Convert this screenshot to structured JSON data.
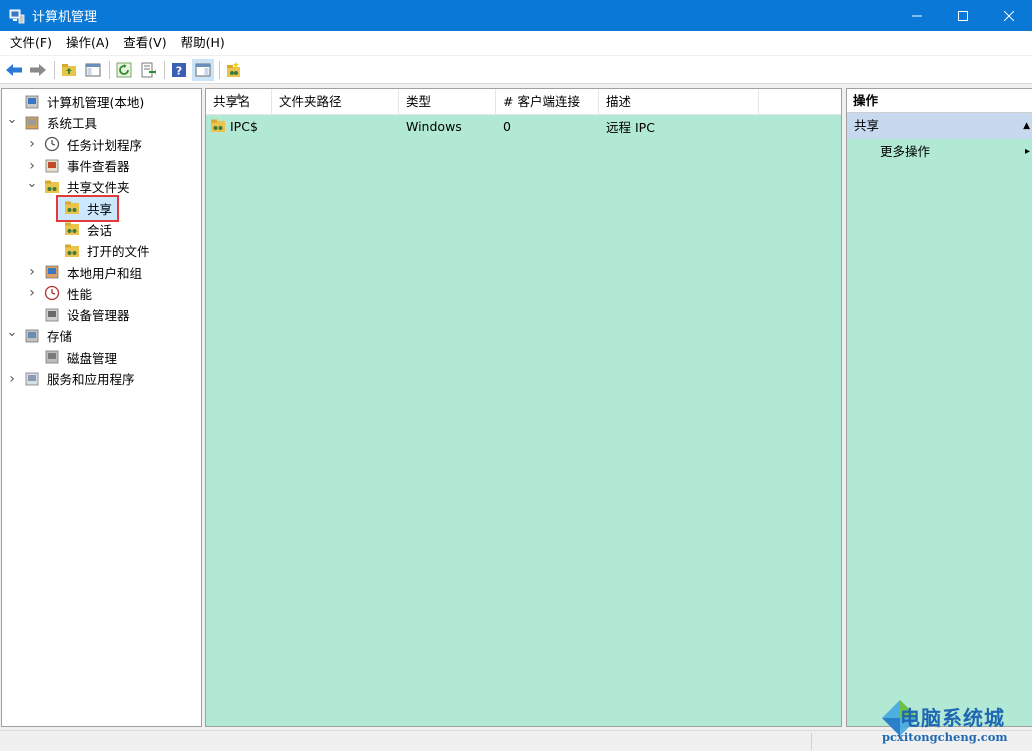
{
  "window": {
    "title": "计算机管理",
    "minimize_icon": "minimize-icon",
    "maximize_icon": "maximize-icon",
    "close_icon": "close-icon",
    "accent": "#0a78d7"
  },
  "menu": [
    "文件(F)",
    "操作(A)",
    "查看(V)",
    "帮助(H)"
  ],
  "tree": [
    {
      "label": "计算机管理(本地)",
      "icon": "computer-management-icon",
      "level": 0,
      "arrow": ""
    },
    {
      "label": "系统工具",
      "icon": "system-tools-icon",
      "level": 0,
      "arrow": "expanded"
    },
    {
      "label": "任务计划程序",
      "icon": "task-scheduler-icon",
      "level": 1,
      "arrow": "collapsed"
    },
    {
      "label": "事件查看器",
      "icon": "event-viewer-icon",
      "level": 1,
      "arrow": "collapsed"
    },
    {
      "label": "共享文件夹",
      "icon": "shared-folder-icon",
      "level": 1,
      "arrow": "expanded"
    },
    {
      "label": "共享",
      "icon": "shares-icon",
      "level": 2,
      "arrow": "",
      "selected": true
    },
    {
      "label": "会话",
      "icon": "sessions-icon",
      "level": 2,
      "arrow": ""
    },
    {
      "label": "打开的文件",
      "icon": "open-files-icon",
      "level": 2,
      "arrow": ""
    },
    {
      "label": "本地用户和组",
      "icon": "local-users-icon",
      "level": 1,
      "arrow": "collapsed"
    },
    {
      "label": "性能",
      "icon": "performance-icon",
      "level": 1,
      "arrow": "collapsed"
    },
    {
      "label": "设备管理器",
      "icon": "device-manager-icon",
      "level": 1,
      "arrow": ""
    },
    {
      "label": "存储",
      "icon": "storage-icon",
      "level": 0,
      "arrow": "expanded"
    },
    {
      "label": "磁盘管理",
      "icon": "disk-management-icon",
      "level": 1,
      "arrow": ""
    },
    {
      "label": "服务和应用程序",
      "icon": "services-apps-icon",
      "level": 0,
      "arrow": "collapsed"
    }
  ],
  "list": {
    "columns": [
      "共享名",
      "文件夹路径",
      "类型",
      "# 客户端连接",
      "描述"
    ],
    "rows": [
      {
        "name": "IPC$",
        "path": "",
        "type": "Windows",
        "connections": "0",
        "description": "远程 IPC",
        "icon": "share-icon"
      }
    ],
    "background": "#b2e9d4"
  },
  "actions": {
    "header": "操作",
    "section": "共享",
    "items": [
      "更多操作"
    ]
  },
  "watermark": {
    "text": "电脑系统城",
    "url": "pcxitongcheng.com"
  }
}
